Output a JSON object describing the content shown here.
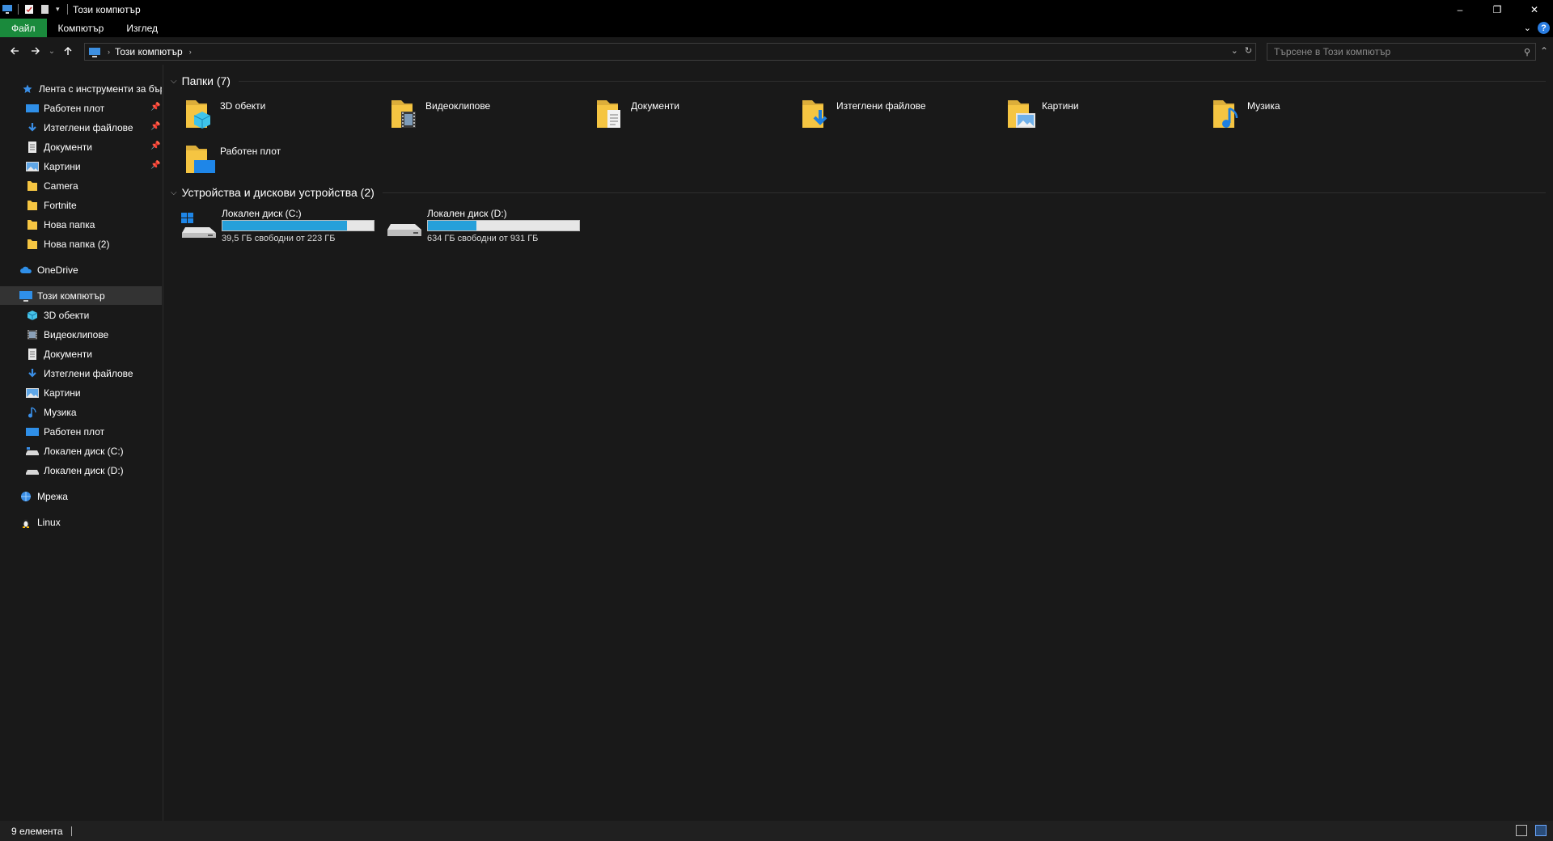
{
  "window": {
    "title": "Този компютър",
    "minimize": "–",
    "restore": "❐",
    "close": "✕"
  },
  "ribbon": {
    "tabs": [
      "Файл",
      "Компютър",
      "Изглед"
    ],
    "help": "?"
  },
  "address": {
    "path": "Този компютър",
    "search_placeholder": "Търсене в Този компютър"
  },
  "sidebar": {
    "quick_access": {
      "label": "Лента с инструменти за бърз достъп",
      "items": [
        {
          "label": "Работен плот",
          "icon": "desktop-icon",
          "pinned": true
        },
        {
          "label": "Изтеглени файлове",
          "icon": "download-icon",
          "pinned": true
        },
        {
          "label": "Документи",
          "icon": "documents-icon",
          "pinned": true
        },
        {
          "label": "Картини",
          "icon": "pictures-icon",
          "pinned": true
        },
        {
          "label": "Camera",
          "icon": "folder-icon",
          "pinned": false
        },
        {
          "label": "Fortnite",
          "icon": "folder-icon",
          "pinned": false
        },
        {
          "label": "Нова папка",
          "icon": "folder-icon",
          "pinned": false
        },
        {
          "label": "Нова папка (2)",
          "icon": "folder-icon",
          "pinned": false
        }
      ]
    },
    "onedrive": "OneDrive",
    "this_pc": {
      "label": "Този компютър",
      "items": [
        {
          "label": "3D обекти",
          "icon": "3d-objects-icon"
        },
        {
          "label": "Видеоклипове",
          "icon": "videos-icon"
        },
        {
          "label": "Документи",
          "icon": "documents-icon"
        },
        {
          "label": "Изтеглени файлове",
          "icon": "download-icon"
        },
        {
          "label": "Картини",
          "icon": "pictures-icon"
        },
        {
          "label": "Музика",
          "icon": "music-icon"
        },
        {
          "label": "Работен плот",
          "icon": "desktop-icon"
        },
        {
          "label": "Локален диск (C:)",
          "icon": "drive-icon"
        },
        {
          "label": "Локален диск (D:)",
          "icon": "drive-icon"
        }
      ]
    },
    "network": "Мрежа",
    "linux": "Linux"
  },
  "content": {
    "folders_header": "Папки (7)",
    "folders": [
      {
        "label": "3D обекти",
        "icon": "3d-objects-folder-icon"
      },
      {
        "label": "Видеоклипове",
        "icon": "videos-folder-icon"
      },
      {
        "label": "Документи",
        "icon": "documents-folder-icon"
      },
      {
        "label": "Изтеглени файлове",
        "icon": "downloads-folder-icon"
      },
      {
        "label": "Картини",
        "icon": "pictures-folder-icon"
      },
      {
        "label": "Музика",
        "icon": "music-folder-icon"
      },
      {
        "label": "Работен плот",
        "icon": "desktop-folder-icon"
      }
    ],
    "drives_header": "Устройства и дискови устройства (2)",
    "drives": [
      {
        "label": "Локален диск (C:)",
        "info": "39,5 ГБ свободни от 223 ГБ",
        "used_fraction": 0.823,
        "system": true
      },
      {
        "label": "Локален диск (D:)",
        "info": "634 ГБ свободни от 931 ГБ",
        "used_fraction": 0.319,
        "system": false
      }
    ]
  },
  "status": {
    "items_count": "9 елемента"
  },
  "colors": {
    "accent_blue": "#26a0da",
    "file_tab_green": "#1a8a3c",
    "folder_yellow": "#f5c542"
  }
}
